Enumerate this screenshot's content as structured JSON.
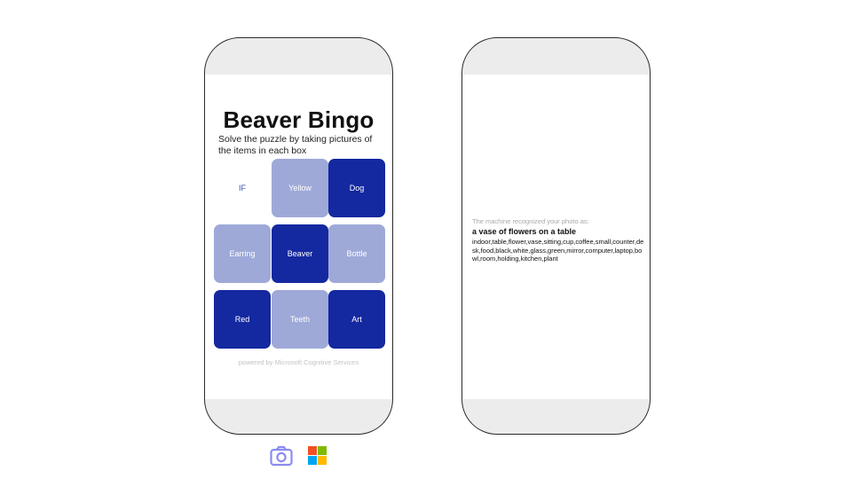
{
  "left_phone": {
    "title": "Beaver Bingo",
    "subtitle": "Solve the puzzle by taking pictures of the items in each box",
    "grid": [
      {
        "label": "IF",
        "state": "blank"
      },
      {
        "label": "Yellow",
        "state": "light"
      },
      {
        "label": "Dog",
        "state": "dark"
      },
      {
        "label": "Earring",
        "state": "light"
      },
      {
        "label": "Beaver",
        "state": "dark"
      },
      {
        "label": "Bottle",
        "state": "light"
      },
      {
        "label": "Red",
        "state": "dark"
      },
      {
        "label": "Teeth",
        "state": "light"
      },
      {
        "label": "Art",
        "state": "dark"
      }
    ],
    "powered_by": "powered by Microsoft Cognitive Services"
  },
  "right_phone": {
    "intro": "The machine recognized your photo as:",
    "caption": "a vase of flowers on a table",
    "tags": "indoor,table,flower,vase,sitting,cup,coffee,small,counter,desk,food,black,white,glass,green,mirror,computer,laptop,bowl,room,holding,kitchen,plant"
  },
  "footer_icons": [
    "camera-icon",
    "microsoft-logo-icon"
  ],
  "colors": {
    "tile_dark": "#1428a0",
    "tile_light": "#9fa9d8",
    "camera_icon": "#8a8cf0",
    "ms_red": "#f25022",
    "ms_green": "#7fba00",
    "ms_blue": "#00a4ef",
    "ms_yellow": "#ffb900"
  }
}
